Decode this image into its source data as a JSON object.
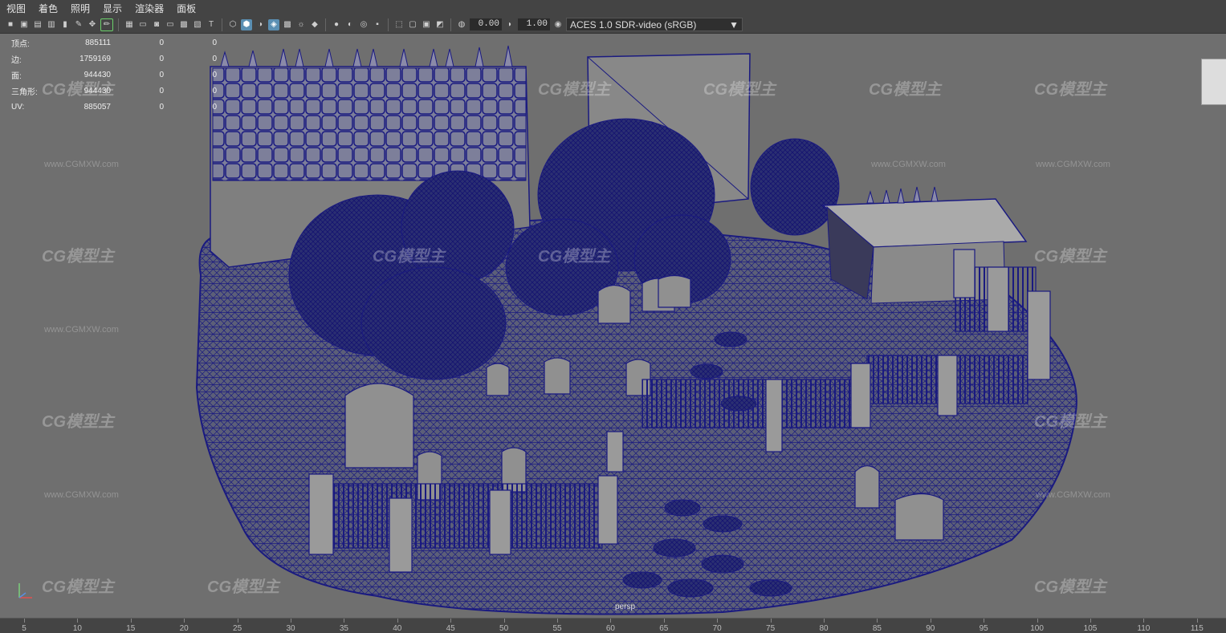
{
  "menu": [
    "视图",
    "着色",
    "照明",
    "显示",
    "渲染器",
    "面板"
  ],
  "toolbar": {
    "value_a": "0.00",
    "value_b": "1.00",
    "color_space": "ACES 1.0 SDR-video (sRGB)"
  },
  "hud": [
    {
      "label": "顶点:",
      "v1": "885111",
      "v2": "0",
      "v3": "0"
    },
    {
      "label": "边:",
      "v1": "1759169",
      "v2": "0",
      "v3": "0"
    },
    {
      "label": "面:",
      "v1": "944430",
      "v2": "0",
      "v3": "0"
    },
    {
      "label": "三角形:",
      "v1": "944430",
      "v2": "0",
      "v3": "0"
    },
    {
      "label": "UV:",
      "v1": "885057",
      "v2": "0",
      "v3": "0"
    }
  ],
  "camera_label": "persp",
  "watermark": {
    "logo": "CG模型主",
    "url": "www.CGMXW.com"
  },
  "timeline_ticks": [
    "5",
    "10",
    "15",
    "20",
    "25",
    "30",
    "35",
    "40",
    "45",
    "50",
    "55",
    "60",
    "65",
    "70",
    "75",
    "80",
    "85",
    "90",
    "95",
    "100",
    "105",
    "110",
    "115"
  ],
  "colors": {
    "wire": "#1a1a80",
    "viewport_bg": "#6f6f6f",
    "accent": "#5a8fb3"
  }
}
